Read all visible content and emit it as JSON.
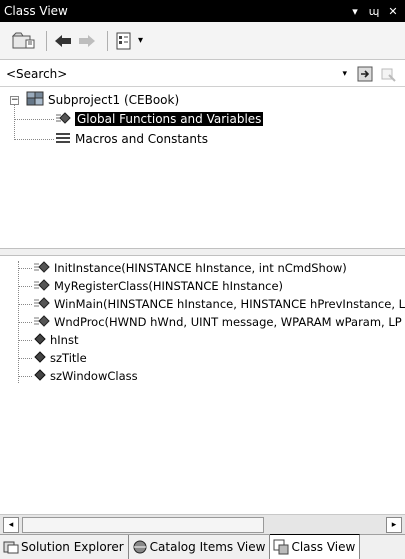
{
  "window": {
    "title": "Class View",
    "dropdown_glyph": "▾",
    "pin_glyph": "ɰ",
    "close_glyph": "✕"
  },
  "toolbar": {
    "icons": [
      "folder-browse-icon",
      "back-arrow-icon",
      "forward-arrow-icon",
      "view-settings-icon"
    ],
    "dropdown_glyph": "▾"
  },
  "search": {
    "text": "<Search>",
    "dropdown_glyph": "▾",
    "icons": [
      "search-go-icon",
      "search-settings-icon"
    ]
  },
  "tree": {
    "expander": "−",
    "project": "Subproject1 (CEBook)",
    "items": [
      {
        "label": "Global Functions and Variables",
        "icon": "global-functions-icon",
        "selected": true
      },
      {
        "label": "Macros and Constants",
        "icon": "macros-icon",
        "selected": false
      }
    ]
  },
  "members": [
    {
      "label": "InitInstance(HINSTANCE hInstance, int nCmdShow)",
      "icon": "method-icon"
    },
    {
      "label": "MyRegisterClass(HINSTANCE hInstance)",
      "icon": "method-icon"
    },
    {
      "label": "WinMain(HINSTANCE hInstance, HINSTANCE hPrevInstance, LP",
      "icon": "method-icon"
    },
    {
      "label": "WndProc(HWND hWnd, UINT message, WPARAM wParam, LP",
      "icon": "method-icon"
    },
    {
      "label": "hInst",
      "icon": "variable-icon"
    },
    {
      "label": "szTitle",
      "icon": "variable-icon"
    },
    {
      "label": "szWindowClass",
      "icon": "variable-icon"
    }
  ],
  "scrollbar": {
    "left_glyph": "◂",
    "right_glyph": "▸"
  },
  "tabs": [
    {
      "label": "Solution Explorer",
      "icon": "solution-explorer-icon",
      "active": false
    },
    {
      "label": "Catalog Items View",
      "icon": "catalog-items-icon",
      "active": false
    },
    {
      "label": "Class View",
      "icon": "class-view-icon",
      "active": true
    }
  ]
}
